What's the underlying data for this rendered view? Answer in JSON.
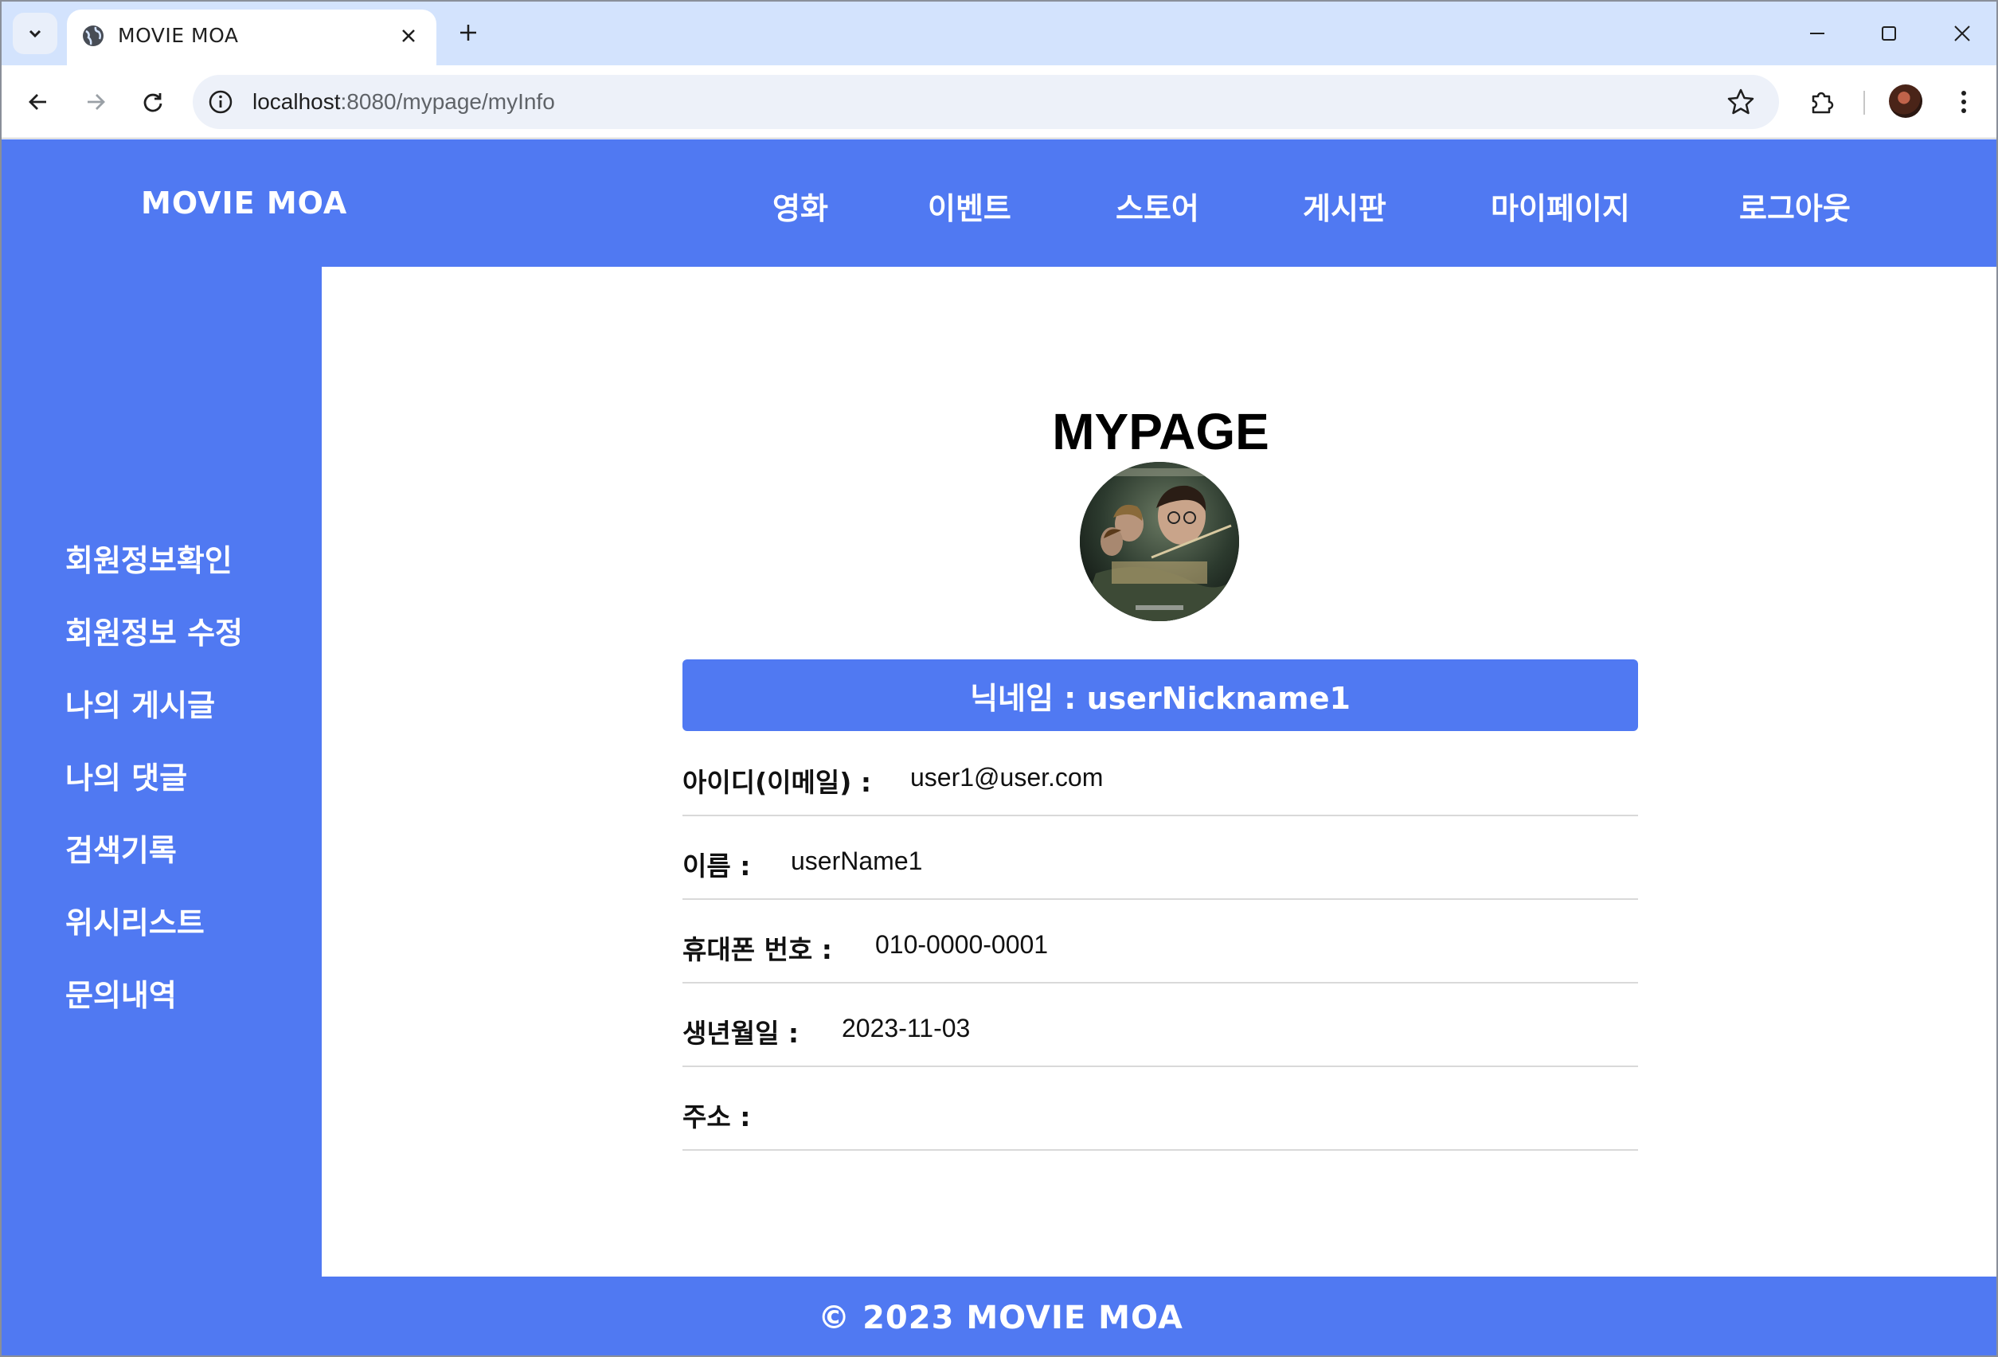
{
  "browser": {
    "tab_title": "MOVIE MOA",
    "url_host": "localhost",
    "url_rest": ":8080/mypage/myInfo"
  },
  "header": {
    "brand": "MOVIE MOA",
    "nav": [
      "영화",
      "이벤트",
      "스토어",
      "게시판",
      "마이페이지",
      "로그아웃"
    ]
  },
  "sidebar": {
    "items": [
      "회원정보확인",
      "회원정보 수정",
      "나의 게시글",
      "나의 댓글",
      "검색기록",
      "위시리스트",
      "문의내역"
    ]
  },
  "main": {
    "title": "MYPAGE",
    "nickname_label": "닉네임 : userNickname1",
    "rows": [
      {
        "label": "아이디(이메일) :",
        "value": "user1@user.com"
      },
      {
        "label": "이름 :",
        "value": "userName1"
      },
      {
        "label": "휴대폰 번호 :",
        "value": "010-0000-0001"
      },
      {
        "label": "생년월일 :",
        "value": "2023-11-03"
      },
      {
        "label": "주소 :",
        "value": ""
      }
    ]
  },
  "footer": {
    "text": "© 2023 MOVIE MOA"
  },
  "colors": {
    "brand_blue": "#5079f2",
    "tab_strip": "#d3e3fd"
  },
  "icons": [
    "tab-search-icon",
    "globe-icon",
    "close-icon",
    "plus-icon",
    "minimize-icon",
    "maximize-icon",
    "back-icon",
    "forward-icon",
    "reload-icon",
    "info-icon",
    "star-icon",
    "extensions-icon",
    "kebab-menu-icon"
  ]
}
